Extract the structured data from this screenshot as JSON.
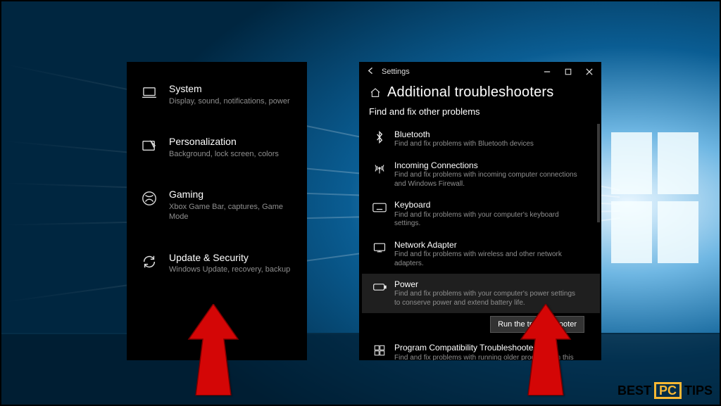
{
  "categories": [
    {
      "icon": "laptop",
      "title": "System",
      "sub": "Display, sound, notifications, power"
    },
    {
      "icon": "personalize",
      "title": "Personalization",
      "sub": "Background, lock screen, colors"
    },
    {
      "icon": "gaming",
      "title": "Gaming",
      "sub": "Xbox Game Bar, captures, Game Mode"
    },
    {
      "icon": "update",
      "title": "Update & Security",
      "sub": "Windows Update, recovery, backup"
    }
  ],
  "tsWindow": {
    "titlebarTitle": "Settings",
    "heading": "Additional troubleshooters",
    "subheading": "Find and fix other problems",
    "runLabel": "Run the troubleshooter",
    "items": [
      {
        "icon": "bluetooth",
        "title": "Bluetooth",
        "desc": "Find and fix problems with Bluetooth devices"
      },
      {
        "icon": "antenna",
        "title": "Incoming Connections",
        "desc": "Find and fix problems with incoming computer connections and Windows Firewall."
      },
      {
        "icon": "keyboard",
        "title": "Keyboard",
        "desc": "Find and fix problems with your computer's keyboard settings."
      },
      {
        "icon": "network",
        "title": "Network Adapter",
        "desc": "Find and fix problems with wireless and other network adapters."
      },
      {
        "icon": "power",
        "title": "Power",
        "desc": "Find and fix problems with your computer's power settings to conserve power and extend battery life.",
        "selected": true
      },
      {
        "icon": "compat",
        "title": "Program Compatibility Troubleshooter",
        "desc": "Find and fix problems with running older programs on this version of Windows."
      }
    ]
  },
  "watermark": {
    "left": "BEST",
    "mid": "PC",
    "right": "TIPS"
  }
}
